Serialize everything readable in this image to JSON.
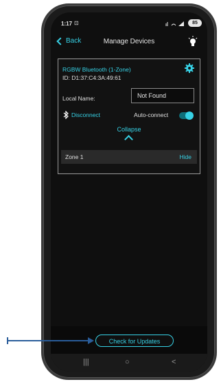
{
  "status_bar": {
    "time": "1:17",
    "camera_glyph": "⊡",
    "battery": "85"
  },
  "nav": {
    "back_label": "Back",
    "title": "Manage Devices"
  },
  "device": {
    "name": "RGBW Bluetooth (1-Zone)",
    "id": "ID: D1:37:C4:3A:49:61",
    "local_name_label": "Local Name:",
    "local_name_value": "Not Found",
    "disconnect_label": "Disconnect",
    "auto_connect_label": "Auto-connect",
    "auto_connect_on": true,
    "collapse_label": "Collapse",
    "zones": [
      {
        "label": "Zone 1",
        "action": "Hide"
      }
    ]
  },
  "footer": {
    "update_button": "Check for Updates"
  },
  "colors": {
    "accent": "#37d2e6",
    "background": "#0f0f0f",
    "callout": "#2a5d9a"
  }
}
